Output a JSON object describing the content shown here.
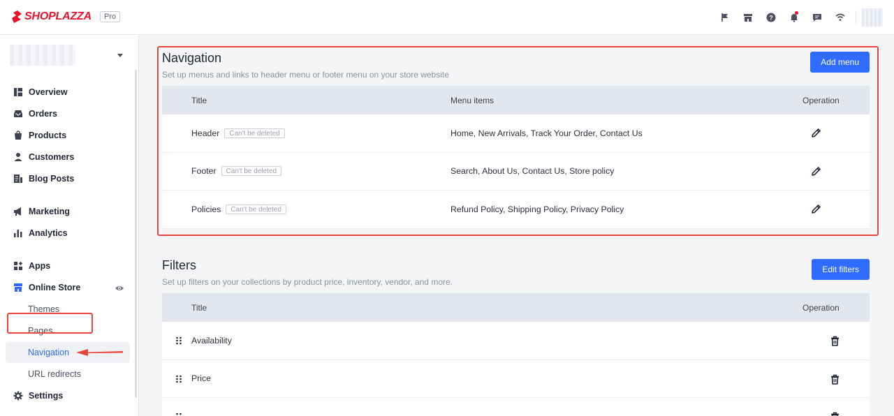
{
  "header": {
    "brand": "SHOPLAZZA",
    "plan_badge": "Pro",
    "icons": [
      "flag-icon",
      "store-icon",
      "help-icon",
      "bell-icon",
      "chat-icon",
      "wifi-icon"
    ]
  },
  "sidebar": {
    "items": [
      {
        "label": "Overview",
        "icon": "overview-icon"
      },
      {
        "label": "Orders",
        "icon": "inbox-icon"
      },
      {
        "label": "Products",
        "icon": "bag-icon"
      },
      {
        "label": "Customers",
        "icon": "person-icon"
      },
      {
        "label": "Blog Posts",
        "icon": "document-icon"
      },
      {
        "label": "Marketing",
        "icon": "megaphone-icon"
      },
      {
        "label": "Analytics",
        "icon": "bar-chart-icon"
      },
      {
        "label": "Apps",
        "icon": "apps-icon"
      },
      {
        "label": "Online Store",
        "icon": "storefront-icon"
      }
    ],
    "online_store_sub": [
      {
        "label": "Themes"
      },
      {
        "label": "Pages"
      },
      {
        "label": "Navigation",
        "active": true
      },
      {
        "label": "URL redirects"
      }
    ],
    "settings": {
      "label": "Settings",
      "icon": "gear-icon"
    }
  },
  "navigation": {
    "title": "Navigation",
    "description": "Set up menus and links to header menu or footer menu on your store website",
    "add_button": "Add menu",
    "columns": {
      "title": "Title",
      "items": "Menu items",
      "operation": "Operation"
    },
    "rows": [
      {
        "title": "Header",
        "tag": "Can't be deleted",
        "items": "Home, New Arrivals, Track Your Order, Contact Us"
      },
      {
        "title": "Footer",
        "tag": "Can't be deleted",
        "items": "Search, About Us, Contact Us, Store policy"
      },
      {
        "title": "Policies",
        "tag": "Can't be deleted",
        "items": "Refund Policy, Shipping Policy, Privacy Policy"
      }
    ]
  },
  "filters": {
    "title": "Filters",
    "description": "Set up filters on your collections by product price, inventory, vendor, and more.",
    "edit_button": "Edit filters",
    "columns": {
      "title": "Title",
      "operation": "Operation"
    },
    "rows": [
      {
        "title": "Availability"
      },
      {
        "title": "Price"
      }
    ]
  },
  "colors": {
    "brand_red": "#e8142d",
    "primary_blue": "#2f6bff",
    "highlight_red": "#e8453c"
  }
}
